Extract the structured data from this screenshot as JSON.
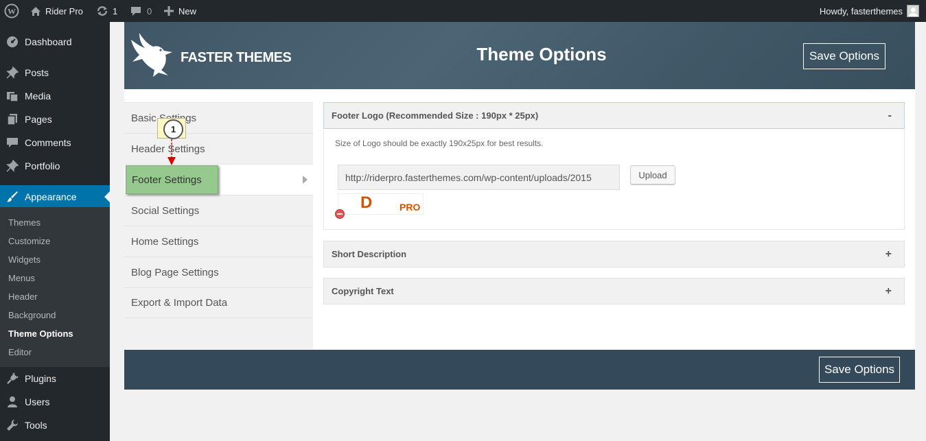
{
  "adminbar": {
    "site_name": "Rider Pro",
    "updates_count": "1",
    "comments_count": "0",
    "new_label": "New",
    "howdy": "Howdy, fasterthemes"
  },
  "sidebar": {
    "items": [
      {
        "label": "Dashboard",
        "icon": "dashboard-icon"
      },
      {
        "label": "Posts",
        "icon": "pin-icon"
      },
      {
        "label": "Media",
        "icon": "media-icon"
      },
      {
        "label": "Pages",
        "icon": "pages-icon"
      },
      {
        "label": "Comments",
        "icon": "comment-icon"
      },
      {
        "label": "Portfolio",
        "icon": "pin-icon"
      },
      {
        "label": "Appearance",
        "icon": "brush-icon"
      },
      {
        "label": "Plugins",
        "icon": "plug-icon"
      },
      {
        "label": "Users",
        "icon": "user-icon"
      },
      {
        "label": "Tools",
        "icon": "wrench-icon"
      }
    ],
    "submenu": [
      "Themes",
      "Customize",
      "Widgets",
      "Menus",
      "Header",
      "Background",
      "Theme Options",
      "Editor"
    ],
    "current_submenu": "Theme Options"
  },
  "header": {
    "logo_text": "FASTER THEMES",
    "title": "Theme Options",
    "save_label": "Save Options"
  },
  "tabs": [
    "Basic Settings",
    "Header Settings",
    "Footer Settings",
    "Social Settings",
    "Home Settings",
    "Blog Page Settings",
    "Export & Import Data"
  ],
  "active_tab": "Footer Settings",
  "callout": {
    "number": "1"
  },
  "sections": {
    "footer_logo": {
      "title": "Footer Logo (Recommended Size : 190px * 25px)",
      "toggle": "-",
      "help": "Size of Logo should be exactly 190x25px for best results.",
      "url": "http://riderpro.fasterthemes.com/wp-content/uploads/2015",
      "upload_label": "Upload",
      "preview_letter": "D",
      "preview_pro": "PRO"
    },
    "short_description": {
      "title": "Short Description",
      "toggle": "+"
    },
    "copyright": {
      "title": "Copyright Text",
      "toggle": "+"
    }
  },
  "footer": {
    "save_label": "Save Options"
  },
  "colors": {
    "accent": "#0073aa",
    "adminbar": "#23282d",
    "header": "#45606f",
    "highlight": "#96c98e"
  }
}
